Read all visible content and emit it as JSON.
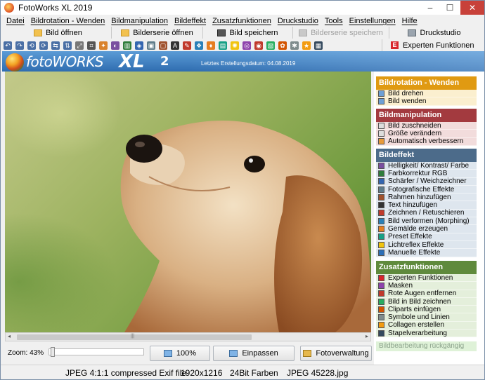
{
  "window": {
    "title": "FotoWorks XL 2019"
  },
  "window_controls": {
    "minimize": "–",
    "maximize": "☐",
    "close": "✕"
  },
  "menu": [
    "Datei",
    "Bildrotation - Wenden",
    "Bildmanipulation",
    "Bildeffekt",
    "Zusatzfunktionen",
    "Druckstudio",
    "Tools",
    "Einstellungen",
    "Hilfe"
  ],
  "quickbar": {
    "open_image": "Bild öffnen",
    "open_series": "Bilderserie öffnen",
    "save_image": "Bild speichern",
    "save_series": "Bilderserie speichern",
    "print_studio": "Druckstudio"
  },
  "toolbar_icons": [
    "rotate-left-icon",
    "rotate-right-icon",
    "rotate-ccw-icon",
    "rotate-cw-icon",
    "flip-horizontal-icon",
    "flip-vertical-icon",
    "resize-icon",
    "crop-icon",
    "enhance-icon",
    "color-adjust-icon",
    "levels-icon",
    "sharpen-icon",
    "photo-effects-icon",
    "frame-icon",
    "text-icon",
    "retouch-icon",
    "morph-icon",
    "painting-icon",
    "preset-icon",
    "lightflex-icon",
    "mask-icon",
    "red-eye-icon",
    "picture-in-picture-icon",
    "cliparts-icon",
    "symbols-icon",
    "collage-icon",
    "batch-icon"
  ],
  "expert_button": "Experten Funktionen",
  "expert_icon_letter": "E",
  "banner": {
    "logo_text": "fotoWORKS",
    "logo_xl": "XL",
    "logo_version": "2",
    "created_label": "Letztes Erstellungsdatum: 04.08.2019"
  },
  "scrollbar": {
    "left_arrow": "◂",
    "right_arrow": "▸",
    "grip": "|||"
  },
  "zoom": {
    "label": "Zoom: 43%",
    "level_percent": 43,
    "btn_100": "100%",
    "btn_fit": "Einpassen",
    "btn_manager": "Fotoverwaltung"
  },
  "status": {
    "format": "JPEG 4:1:1 compressed Exif file",
    "dimensions": "1920x1216",
    "color_depth": "24Bit Farben",
    "filename": "JPEG 45228.jpg"
  },
  "panel": {
    "sections": [
      {
        "title": "Bildrotation - Wenden",
        "color": "#e09a12",
        "bg": "#fbefcf",
        "items": [
          {
            "label": "Bild drehen",
            "icon": "rotate-icon"
          },
          {
            "label": "Bild wenden",
            "icon": "flip-icon"
          }
        ]
      },
      {
        "title": "Bildmanipulation",
        "color": "#a33a3f",
        "bg": "#f2dcdc",
        "items": [
          {
            "label": "Bild zuschneiden",
            "icon": "crop-icon"
          },
          {
            "label": "Größe verändern",
            "icon": "resize-icon"
          },
          {
            "label": "Automatisch verbessern",
            "icon": "magic-icon"
          }
        ]
      },
      {
        "title": "Bildeffekt",
        "color": "#4c6b8a",
        "bg": "#dee6ee",
        "items": [
          {
            "label": "Helligkeit/ Kontrast/ Farbe",
            "icon": "brightness-icon"
          },
          {
            "label": "Farbkorrektur RGB",
            "icon": "rgb-icon"
          },
          {
            "label": "Schärfer / Weichzeichner",
            "icon": "sharpen-icon"
          },
          {
            "label": "Fotografische Effekte",
            "icon": "photo-effects-icon"
          },
          {
            "label": "Rahmen hinzufügen",
            "icon": "frame-icon"
          },
          {
            "label": "Text hinzufügen",
            "icon": "text-icon"
          },
          {
            "label": "Zeichnen / Retuschieren",
            "icon": "draw-icon"
          },
          {
            "label": "Bild verformen (Morphing)",
            "icon": "morph-icon"
          },
          {
            "label": "Gemälde erzeugen",
            "icon": "painting-icon"
          },
          {
            "label": "Preset Effekte",
            "icon": "preset-icon"
          },
          {
            "label": "Lichtreflex Effekte",
            "icon": "lightflex-icon"
          },
          {
            "label": "Manuelle Effekte",
            "icon": "manual-effects-icon"
          }
        ]
      },
      {
        "title": "Zusatzfunktionen",
        "color": "#5f8a3c",
        "bg": "#e4efdb",
        "items": [
          {
            "label": "Experten Funktionen",
            "icon": "expert-icon"
          },
          {
            "label": "Masken",
            "icon": "mask-icon"
          },
          {
            "label": "Rote Augen entfernen",
            "icon": "red-eye-icon"
          },
          {
            "label": "Bild in Bild zeichnen",
            "icon": "picture-in-picture-icon"
          },
          {
            "label": "Cliparts einfügen",
            "icon": "cliparts-icon"
          },
          {
            "label": "Symbole und Linien",
            "icon": "symbols-icon"
          },
          {
            "label": "Collagen erstellen",
            "icon": "collage-icon"
          },
          {
            "label": "Stapelverarbeitung",
            "icon": "batch-icon"
          }
        ]
      }
    ],
    "undo_label": "Bildbearbeitung rückgängig"
  },
  "colors": {
    "banner": "#3a7cc0",
    "close_button": "#c8413a",
    "expert_icon": "#d8262c"
  }
}
